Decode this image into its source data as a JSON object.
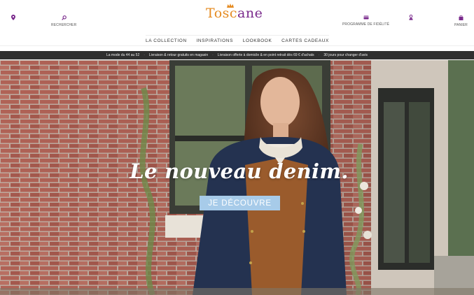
{
  "header": {
    "store_icon": "map-pin-icon",
    "search": {
      "icon": "search-icon",
      "label": "RECHERCHER"
    },
    "loyalty": {
      "icon": "loyalty-card-icon",
      "label": "PROGRAMME DE FIDÉLITÉ"
    },
    "account_icon": "user-icon",
    "cart": {
      "icon": "shopping-bag-icon",
      "label": "PANIER"
    },
    "logo": {
      "text_main": "Tosc",
      "text_accent": "ane",
      "colors": {
        "orange": "#e58b21",
        "purple": "#7a2a8c"
      }
    }
  },
  "nav": {
    "items": [
      "LA COLLECTION",
      "INSPIRATIONS",
      "LOOKBOOK",
      "CARTES CADEAUX"
    ]
  },
  "promo": {
    "messages": [
      "La mode du 44 au 52",
      "Livraison & retour gratuits en magasin",
      "Livraison offerte à domicile & en point retrait dès 69 € d'achats",
      "30 jours pour changer d'avis"
    ],
    "separator": "·"
  },
  "hero": {
    "headline": "Le nouveau denim.",
    "cta_label": "JE DÉCOUVRE",
    "cta_color": "#a7cbe9"
  },
  "colors": {
    "icon_purple": "#7a2a8c",
    "promo_bg": "#2f2f2f"
  }
}
